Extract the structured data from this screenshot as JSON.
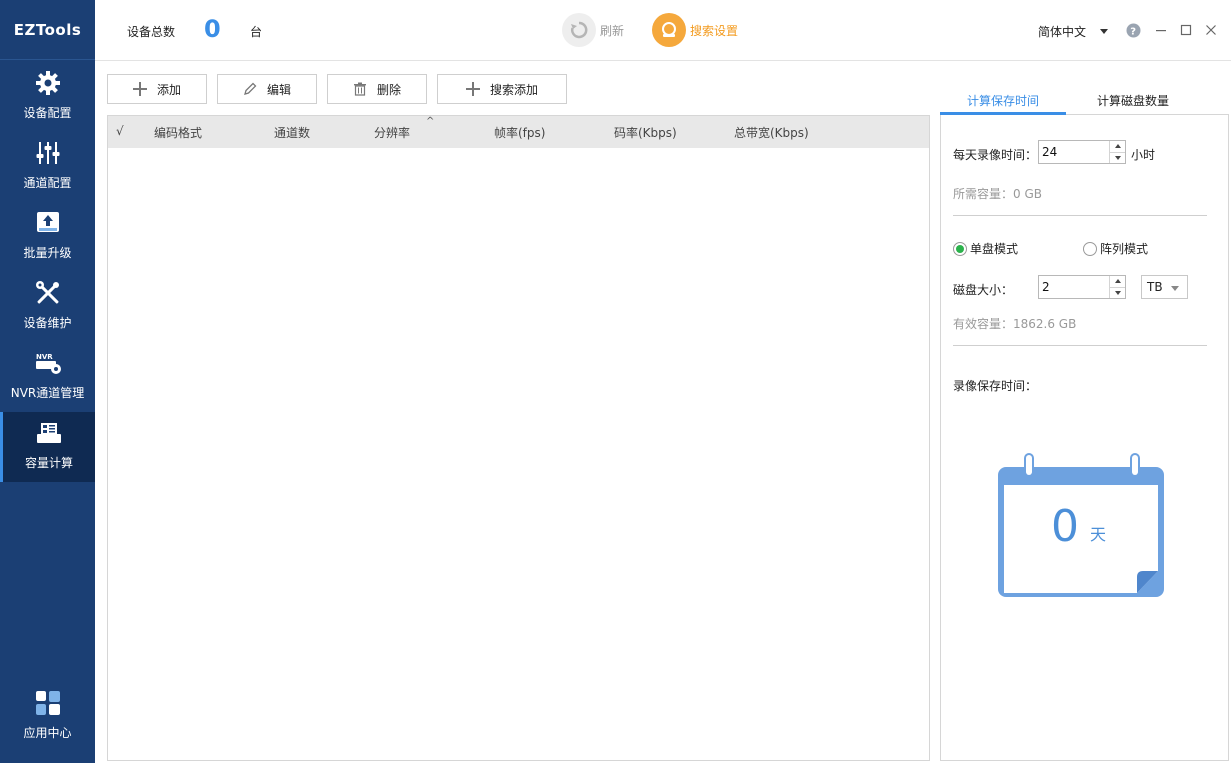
{
  "app": {
    "title": "EZTools"
  },
  "sidebar": {
    "items": [
      {
        "label": "设备配置",
        "icon": "gear-icon"
      },
      {
        "label": "通道配置",
        "icon": "sliders-icon"
      },
      {
        "label": "批量升级",
        "icon": "upgrade-icon"
      },
      {
        "label": "设备维护",
        "icon": "tools-icon"
      },
      {
        "label": "NVR通道管理",
        "icon": "nvr-icon"
      },
      {
        "label": "容量计算",
        "icon": "calculator-icon",
        "active": true
      }
    ],
    "bottom": {
      "label": "应用中心",
      "icon": "app-center-icon"
    }
  },
  "topbar": {
    "total_label": "设备总数",
    "total_value": "0",
    "unit": "台",
    "refresh_label": "刷新",
    "search_settings_label": "搜索设置",
    "language": "简体中文"
  },
  "toolbar": {
    "add_label": "添加",
    "edit_label": "编辑",
    "delete_label": "删除",
    "search_add_label": "搜索添加"
  },
  "table": {
    "columns": [
      "√",
      "编码格式",
      "通道数",
      "分辨率",
      "帧率(fps)",
      "码率(Kbps)",
      "总带宽(Kbps)"
    ],
    "rows": []
  },
  "right_panel": {
    "tabs": [
      "计算保存时间",
      "计算磁盘数量"
    ],
    "active_tab": 0,
    "daily_record_label": "每天录像时间：",
    "daily_record_value": "24",
    "daily_record_unit": "小时",
    "required_capacity": "所需容量：0 GB",
    "mode_single": "单盘模式",
    "mode_array": "阵列模式",
    "disk_size_label": "磁盘大小：",
    "disk_size_value": "2",
    "disk_unit": "TB",
    "effective_capacity": "有效容量：1862.6 GB",
    "retention_label": "录像保存时间：",
    "retention_days": "0",
    "retention_unit": "天"
  },
  "colors": {
    "sidebar_bg": "#1b3f74",
    "accent": "#3a8ee6",
    "orange": "#f5a83c",
    "radio_on": "#2bb24c"
  }
}
